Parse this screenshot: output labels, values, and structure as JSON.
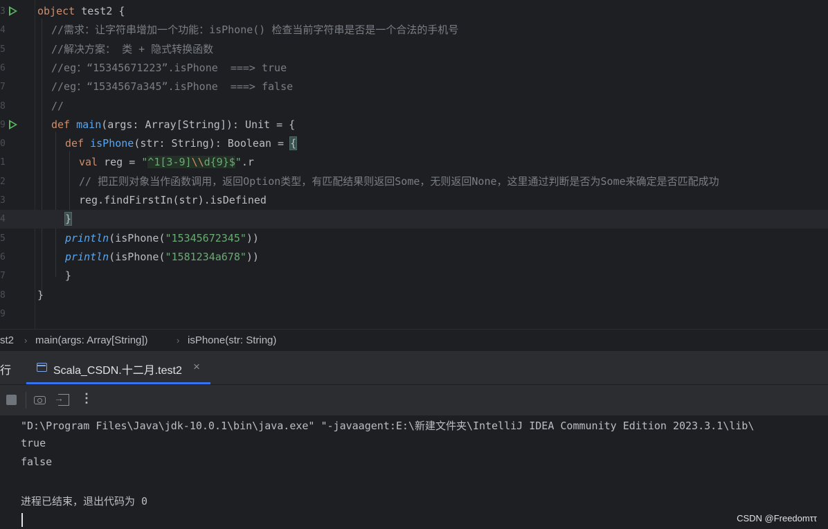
{
  "editor": {
    "lines": [
      {
        "num": "3",
        "run": true
      },
      {
        "num": "4"
      },
      {
        "num": "5"
      },
      {
        "num": "6"
      },
      {
        "num": "7"
      },
      {
        "num": "8"
      },
      {
        "num": "9",
        "run": true
      },
      {
        "num": "0"
      },
      {
        "num": "1"
      },
      {
        "num": "2"
      },
      {
        "num": "3"
      },
      {
        "num": "4",
        "current": true
      },
      {
        "num": "5"
      },
      {
        "num": "6"
      },
      {
        "num": "7"
      },
      {
        "num": "8"
      },
      {
        "num": "9"
      }
    ],
    "code": {
      "l1_kw": "object",
      "l1_rest": " test2 {",
      "l2": "//需求：让字符串增加一个功能：isPhone() 检查当前字符串是否是一个合法的手机号",
      "l3": "//解决方案： 类 + 隐式转换函数",
      "l4": "//eg：“15345671223”.isPhone  ===> true",
      "l5": "//eg：“1534567a345”.isPhone  ===> false",
      "l6": "//",
      "l7_kw": "def",
      "l7_fn": "main",
      "l7_rest": "(args: Array[String]): Unit = {",
      "l8_kw": "def",
      "l8_fn": "isPhone",
      "l8_rest": "(str: String): Boolean = ",
      "l8_brace": "{",
      "l9_kw": "val",
      "l9_mid": " reg = ",
      "l9_q1": "\"",
      "l9_r1": "^1[3-9]",
      "l9_esc": "\\\\",
      "l9_r2": "d{9}$",
      "l9_q2": "\"",
      "l9_rest": ".r",
      "l10": "// 把正则对象当作函数调用，返回Option类型，有匹配结果则返回Some，无则返回None，这里通过判断是否为Some来确定是否匹配成功",
      "l11": "reg.findFirstIn(str).isDefined",
      "l12": "}",
      "l13_fn": "println",
      "l13_a": "(isPhone(",
      "l13_str": "\"15345672345\"",
      "l13_b": "))",
      "l14_fn": "println",
      "l14_a": "(isPhone(",
      "l14_str": "\"1581234a678\"",
      "l14_b": "))",
      "l15": "}",
      "l16": "}"
    }
  },
  "breadcrumb": {
    "items": [
      "st2",
      "main(args: Array[String])",
      "isPhone(str: String)"
    ],
    "separator": "›"
  },
  "run_panel": {
    "title": "行",
    "tab_label": "Scala_CSDN.十二月.test2",
    "tab_close": "×"
  },
  "toolbar": {
    "more_glyph": "⋮"
  },
  "console": {
    "lines": [
      "\"D:\\Program Files\\Java\\jdk-10.0.1\\bin\\java.exe\" \"-javaagent:E:\\新建文件夹\\IntelliJ IDEA Community Edition 2023.3.1\\lib\\",
      "true",
      "false",
      "",
      "进程已结束，退出代码为 0"
    ]
  },
  "watermark": "CSDN @Freedomττ",
  "colors": {
    "keyword": "#cf8e6d",
    "function": "#56a8f5",
    "string": "#6aab73",
    "comment": "#7a7e85",
    "accent": "#3574f0"
  }
}
